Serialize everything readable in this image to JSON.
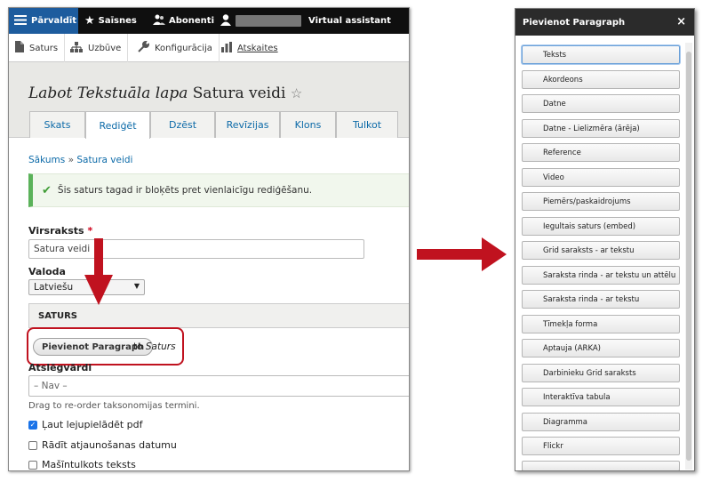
{
  "toolbar": {
    "items": [
      "Pārvaldīt",
      "Saīsnes",
      "Abonenti",
      "Virtual assistant"
    ]
  },
  "tray": {
    "items": [
      "Saturs",
      "Uzbūve",
      "Konfigurācija",
      "Atskaites"
    ]
  },
  "header": {
    "title_italic": "Labot Tekstuāla lapa",
    "title_rest": "Satura veidi",
    "star": "☆",
    "tabs": [
      "Skats",
      "Rediģēt",
      "Dzēst",
      "Revīzijas",
      "Klons",
      "Tulkot"
    ],
    "active_tab": "Rediģēt"
  },
  "breadcrumb": {
    "home": "Sākums",
    "sep": "»",
    "current": "Satura veidi"
  },
  "message": {
    "text": "Šis saturs tagad ir bloķēts pret vienlaicīgu rediģēšanu."
  },
  "form": {
    "title_label": "Virsraksts",
    "required_mark": "*",
    "title_value": "Satura veidi",
    "language_label": "Valoda",
    "language_value": "Latviešu",
    "fieldset_label": "SATURS",
    "add_paragraph_button": "Pievienot Paragraph",
    "add_to_text": "to",
    "add_to_target": "Saturs",
    "keywords_label": "Atslēgvārdi",
    "keywords_value": "– Nav –",
    "drag_hint": "Drag to re-order taksonomijas termini.",
    "checkboxes": [
      {
        "label": "Ļaut lejupielādēt pdf",
        "checked": true
      },
      {
        "label": "Rādīt atjaunošanas datumu",
        "checked": false
      },
      {
        "label": "Mašīntulkots teksts",
        "checked": false
      }
    ]
  },
  "dialog": {
    "title": "Pievienot Paragraph",
    "close": "×",
    "buttons": [
      "Teksts",
      "Akordeons",
      "Datne",
      "Datne - Lielizmēra (ārēja)",
      "Reference",
      "Video",
      "Piemērs/paskaidrojums",
      "Iegultais saturs (embed)",
      "Grid saraksts - ar tekstu",
      "Saraksta rinda - ar tekstu un attēlu",
      "Saraksta rinda - ar tekstu",
      "Tīmekļa forma",
      "Aptauja (ARKA)",
      "Darbinieku Grid saraksts",
      "Interaktīva tabula",
      "Diagramma",
      "Flickr"
    ]
  },
  "colors": {
    "toolbar_bg": "#0f0f0f",
    "active_blue": "#1d5c9e",
    "link_blue": "#0c6aa8",
    "annotation_red": "#c0121f",
    "success_green": "#5bb25a"
  }
}
